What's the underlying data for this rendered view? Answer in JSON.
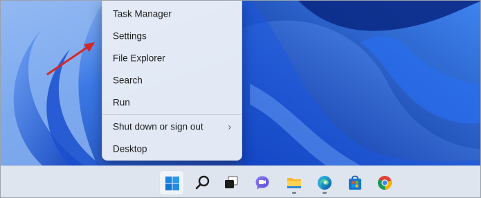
{
  "menu": {
    "items": [
      {
        "label": "Task Manager"
      },
      {
        "label": "Settings"
      },
      {
        "label": "File Explorer"
      },
      {
        "label": "Search"
      },
      {
        "label": "Run"
      },
      {
        "label": "Shut down or sign out"
      },
      {
        "label": "Desktop"
      }
    ],
    "submenu_indicator": "›"
  },
  "taskbar": {
    "icons": [
      {
        "name": "start-icon"
      },
      {
        "name": "search-icon"
      },
      {
        "name": "task-view-icon"
      },
      {
        "name": "chat-icon"
      },
      {
        "name": "file-explorer-icon"
      },
      {
        "name": "edge-icon"
      },
      {
        "name": "store-icon"
      },
      {
        "name": "chrome-icon"
      }
    ]
  },
  "colors": {
    "accent": "#0067c0",
    "annotation_arrow": "#d62828",
    "wallpaper_base": "#1d55c8"
  }
}
